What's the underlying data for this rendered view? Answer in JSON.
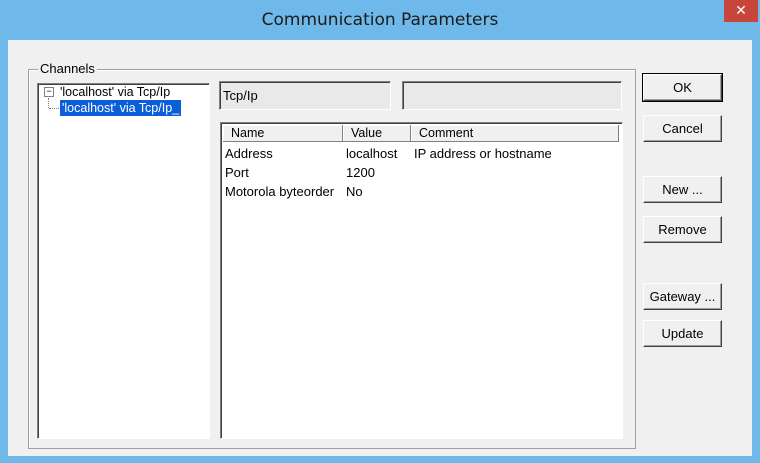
{
  "window": {
    "title": "Communication Parameters",
    "close_glyph": "✕"
  },
  "channels": {
    "label": "Channels",
    "tree": [
      {
        "label": "'localhost' via Tcp/Ip",
        "expander": "−"
      },
      {
        "label": "'localhost' via Tcp/Ip_",
        "selected": true
      }
    ]
  },
  "protocol_field": {
    "value": "Tcp/Ip"
  },
  "name_field": {
    "value": ""
  },
  "params": {
    "columns": [
      "Name",
      "Value",
      "Comment"
    ],
    "rows": [
      {
        "name": "Address",
        "value": "localhost",
        "comment": "IP address or hostname"
      },
      {
        "name": "Port",
        "value": "1200",
        "comment": ""
      },
      {
        "name": "Motorola byteorder",
        "value": "No",
        "comment": ""
      }
    ]
  },
  "buttons": {
    "ok": "OK",
    "cancel": "Cancel",
    "new": "New ...",
    "remove": "Remove",
    "gateway": "Gateway ...",
    "update": "Update"
  },
  "colors": {
    "titlebar": "#6fb9ea",
    "close": "#c8453c",
    "selection": "#0a5fd8"
  }
}
